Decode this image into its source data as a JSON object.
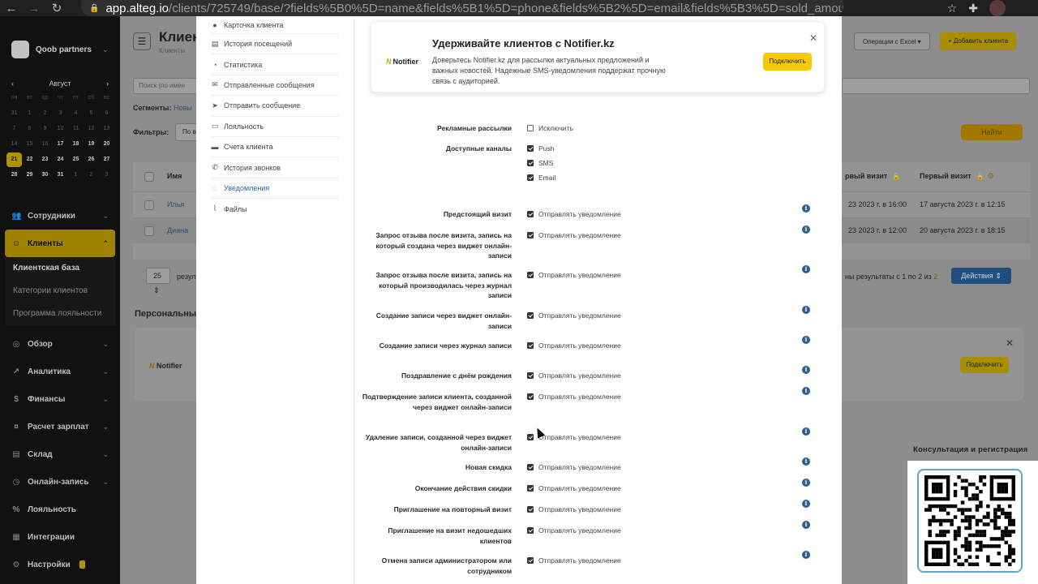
{
  "browser": {
    "url_host": "app.alteg.io",
    "url_path": "/clients/725749/base/?fields%5B0%5D=name&fields%5B1%5D=phone&fields%5B2%5D=email&fields%5B3%5D=sold_amount&fields%5B4..."
  },
  "sidebar": {
    "brand": "Qoob partners",
    "calendar": {
      "month": "Август",
      "weekdays": [
        "пн",
        "вт",
        "ср",
        "чт",
        "пт",
        "сб",
        "вс"
      ],
      "days": [
        [
          "31",
          "1",
          "2",
          "3",
          "4",
          "5",
          "6"
        ],
        [
          "7",
          "8",
          "9",
          "10",
          "11",
          "12",
          "13"
        ],
        [
          "14",
          "15",
          "16",
          "17",
          "18",
          "19",
          "20"
        ],
        [
          "21",
          "22",
          "23",
          "24",
          "25",
          "26",
          "27"
        ],
        [
          "28",
          "29",
          "30",
          "31",
          "1",
          "2",
          "3"
        ]
      ],
      "today": "21"
    },
    "menu": [
      {
        "label": "Сотрудники",
        "icon": "users-icon"
      },
      {
        "label": "Клиенты",
        "icon": "client-icon",
        "active": true
      }
    ],
    "submenu": [
      "Клиентская база",
      "Категории клиентов",
      "Программа лояльности"
    ],
    "menu2": [
      {
        "label": "Обзор",
        "icon": "eye-icon"
      },
      {
        "label": "Аналитика",
        "icon": "analytics-icon"
      },
      {
        "label": "Финансы",
        "icon": "finance-icon"
      },
      {
        "label": "Расчет зарплат",
        "icon": "salary-icon"
      },
      {
        "label": "Склад",
        "icon": "warehouse-icon"
      },
      {
        "label": "Онлайн-запись",
        "icon": "online-booking-icon"
      },
      {
        "label": "Лояльность",
        "icon": "loyalty-icon"
      },
      {
        "label": "Интеграции",
        "icon": "integrations-icon"
      },
      {
        "label": "Настройки",
        "icon": "settings-icon"
      }
    ]
  },
  "bg_page": {
    "title": "Клиен",
    "breadcrumb": "Клиенты",
    "excel": "Операции с Excel",
    "add_client": "Добавить клиента",
    "search_placeholder": "Поиск (по имен",
    "segments_label": "Сегменты:",
    "segments_value": "Новы",
    "filters_label": "Фильтры:",
    "filters_value": "По в",
    "find": "Найти",
    "columns": {
      "name": "Имя",
      "last_visit": "рвый визит",
      "first_visit": "Первый визит"
    },
    "rows": [
      {
        "name": "Илья",
        "last": "23 2023 г. в 16:00",
        "first": "17 августа 2023 г. в 12:15"
      },
      {
        "name": "Диана",
        "last": "23 2023 г. в 12:00",
        "first": "20 августа 2023 г. в 18:15"
      }
    ],
    "per_page": "25",
    "per_page_suffix": "резуль",
    "results_text": "ны результаты с 1 по 2 из ",
    "results_total": "2",
    "actions": "Действия",
    "personal_title": "Персональные",
    "card_logo": "Notifier",
    "card_btn": "Подключить"
  },
  "modal": {
    "nav": [
      {
        "label": "Карточка клиента",
        "icon": "user-icon"
      },
      {
        "label": "История посещений",
        "icon": "history-icon"
      },
      {
        "label": "Статистика",
        "icon": "pie-chart-icon"
      },
      {
        "label": "Отправленные сообщения",
        "icon": "envelope-icon"
      },
      {
        "label": "Отправить сообщение",
        "icon": "paper-plane-icon"
      },
      {
        "label": "Лояльность",
        "icon": "card-icon"
      },
      {
        "label": "Счета клиента",
        "icon": "wallet-icon"
      },
      {
        "label": "История звонков",
        "icon": "phone-icon"
      },
      {
        "label": "Уведомления",
        "icon": "bell-icon",
        "active": true
      },
      {
        "label": "Файлы",
        "icon": "paperclip-icon"
      }
    ],
    "promo": {
      "logo": "Notifier",
      "title": "Удерживайте клиентов с Notifier.kz",
      "description": "Доверьтесь Notifier.kz для рассылки актуальных предложений и важных новостей. Надежные SMS-уведомления поддержат прочную связь с аудиторией.",
      "button": "Подключить"
    },
    "ads": {
      "label": "Рекламные рассылки",
      "option": "Исключить",
      "checked": false
    },
    "channels": {
      "label": "Доступные каналы",
      "options": [
        "Push",
        "SMS",
        "Email"
      ]
    },
    "send_label": "Отправлять уведомление",
    "notifications": [
      "Предстоящий визит",
      "Запрос отзыва после визита, запись на который создана через виджет онлайн-записи",
      "Запрос отзыва после визита, запись на который производилась через журнал записи",
      "Создание записи через виджет онлайн-записи",
      "Создание записи через журнал записи",
      "Поздравление с днём рождения",
      "Подтверждение записи клиента, созданной через виджет онлайн-записи",
      "Удаление записи, созданной через виджет онлайн-записи",
      "Новая скидка",
      "Окончание действия скидки",
      "Приглашение на повторный визит",
      "Приглашение на визит недошедших клиентов",
      "Отмена записи администратором или сотрудником"
    ]
  },
  "overlay": {
    "qr_caption": "Консультация и регистрация"
  }
}
